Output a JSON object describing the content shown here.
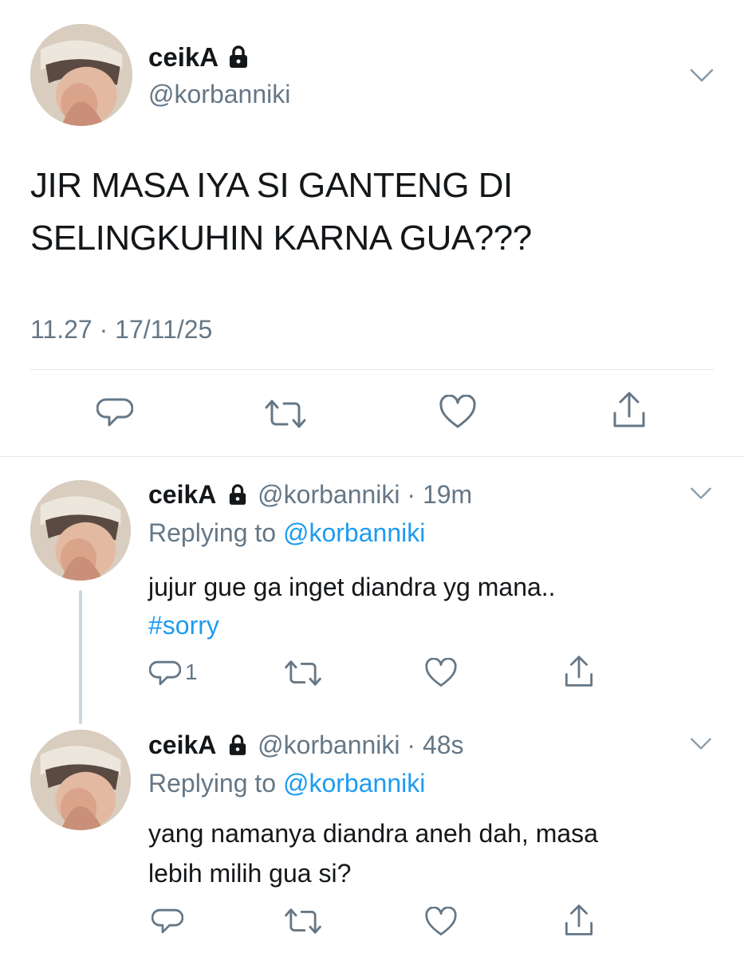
{
  "main_tweet": {
    "display_name": "ceikA",
    "handle": "@korbanniki",
    "text_line1": "JIR MASA IYA SI GANTENG DI",
    "text_line2": "SELINGKUHIN KARNA GUA???",
    "timestamp": "11.27 · 17/11/25"
  },
  "replies": [
    {
      "display_name": "ceikA",
      "handle": "@korbanniki",
      "time": "· 19m",
      "replying_prefix": "Replying to",
      "replying_handle": "@korbanniki",
      "text_line1": "jujur gue ga inget diandra yg mana..",
      "text_line2": "#sorry",
      "reply_count": "1"
    },
    {
      "display_name": "ceikA",
      "handle": "@korbanniki",
      "time": "· 48s",
      "replying_prefix": "Replying to",
      "replying_handle": "@korbanniki",
      "text_line1": "yang namanya diandra aneh dah, masa",
      "text_line2": "lebih milih gua si?",
      "reply_count": ""
    }
  ],
  "colors": {
    "text": "#14171a",
    "secondary": "#657786",
    "link": "#1d9bf0",
    "divider": "#e1e8ed"
  },
  "icons": [
    "lock-icon",
    "chevron-down-icon",
    "reply-icon",
    "retweet-icon",
    "like-icon",
    "share-icon"
  ]
}
